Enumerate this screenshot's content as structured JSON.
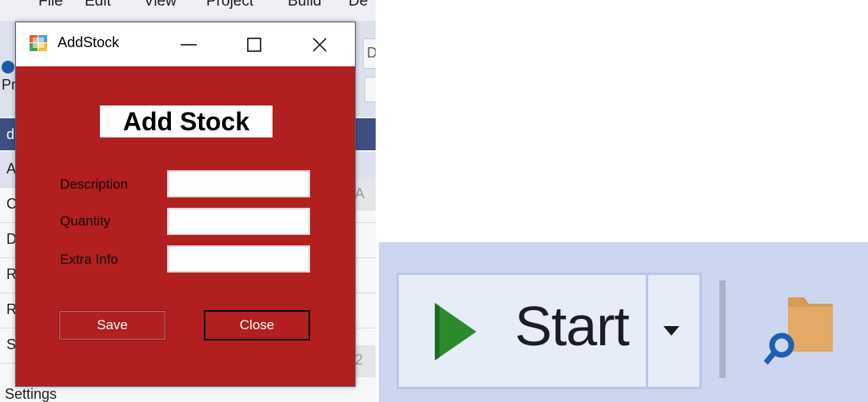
{
  "ide": {
    "menu": [
      "File",
      "Edit",
      "View",
      "Project",
      "Build",
      "De"
    ],
    "toolbar_fragments": [
      "D",
      "Pr"
    ],
    "darkbar_text": "d",
    "rows": [
      "A",
      "C",
      "D",
      "R",
      "R",
      "S"
    ],
    "col_a": "A",
    "col_2": "2",
    "settings": "Settings"
  },
  "dialog": {
    "title": "AddStock",
    "heading": "Add Stock",
    "fields": [
      {
        "label": "Description",
        "value": ""
      },
      {
        "label": "Quantity",
        "value": ""
      },
      {
        "label": "Extra Info",
        "value": ""
      }
    ],
    "save_label": "Save",
    "close_label": "Close",
    "colors": {
      "background": "#b11f1f",
      "titlebar": "#ffffff"
    }
  },
  "zoom_toolbar": {
    "start_label": "Start",
    "icons": [
      "play-icon",
      "dropdown-arrow-icon",
      "find-in-files-icon"
    ]
  }
}
